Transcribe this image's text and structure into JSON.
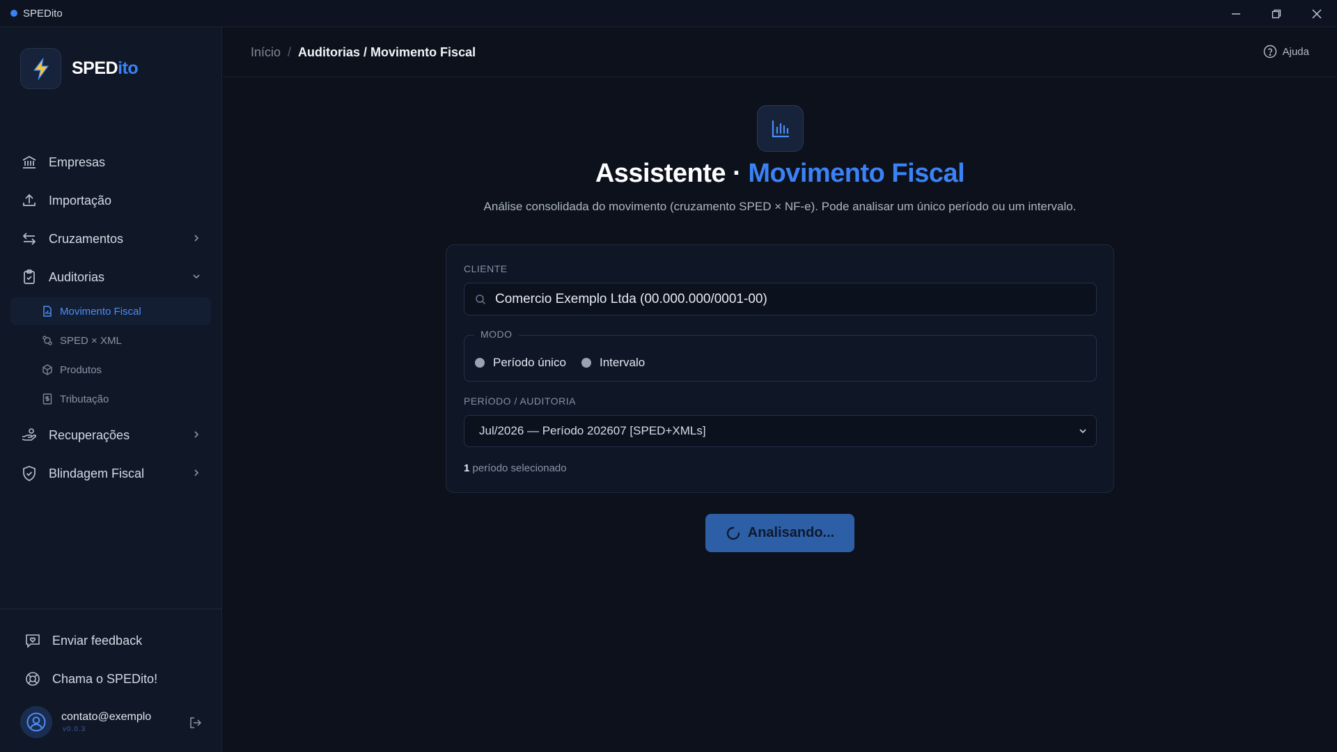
{
  "window": {
    "title": "SPEDito",
    "controls": [
      "minimize-icon",
      "restore-icon",
      "close-icon"
    ]
  },
  "brand": {
    "name_part1": "SPED",
    "name_part2": "ito",
    "logo_icon": "lightning-bolt-icon"
  },
  "sidebar": {
    "items": [
      {
        "label": "Empresas",
        "icon": "bank-icon"
      },
      {
        "label": "Importação",
        "icon": "upload-icon"
      },
      {
        "label": "Cruzamentos",
        "icon": "arrows-exchange-icon"
      },
      {
        "label": "Auditorias",
        "icon": "clipboard-check-icon"
      },
      {
        "label": "Recuperações",
        "icon": "hand-coins-icon"
      },
      {
        "label": "Blindagem Fiscal",
        "icon": "shield-check-icon"
      }
    ],
    "subitems": [
      {
        "label": "Movimento Fiscal",
        "icon": "file-chart-icon",
        "active": true
      },
      {
        "label": "SPED × XML",
        "icon": "git-compare-icon"
      },
      {
        "label": "Produtos",
        "icon": "package-icon"
      },
      {
        "label": "Tributação",
        "icon": "receipt-icon"
      }
    ],
    "footer": [
      {
        "label": "Enviar feedback",
        "icon": "message-heart-icon"
      },
      {
        "label": "Chama o SPEDito!",
        "icon": "lifebuoy-icon"
      }
    ],
    "user": {
      "email": "contato@exemplo",
      "version": "v0.0.3"
    }
  },
  "header": {
    "breadcrumb_home": "Início",
    "breadcrumb_separator": "/",
    "breadcrumb_current": "Auditorias / Movimento Fiscal",
    "help_label": "Ajuda"
  },
  "main": {
    "hero_icon": "bar-chart-icon",
    "title_part1": "Assistente · ",
    "title_part2": "Movimento Fiscal",
    "subtitle": "Análise consolidada do movimento (cruzamento SPED × NF-e). Pode analisar um único período ou um intervalo.",
    "form": {
      "client_label": "CLIENTE",
      "client_value": "Comercio Exemplo Ltda (00.000.000/0001-00)",
      "mode_label": "MODO",
      "mode_options": [
        "Período único",
        "Intervalo"
      ],
      "period_label": "PERÍODO / AUDITORIA",
      "period_value": "Jul/2026 — Período 202607 [SPED+XMLs]",
      "selected_count": "1",
      "selected_text": " período selecionado"
    },
    "analyze_button": "Analisando..."
  },
  "colors": {
    "accent": "#3b82f6",
    "background": "#0c111b",
    "sidebar": "#101827",
    "button": "#2d5fa6"
  }
}
